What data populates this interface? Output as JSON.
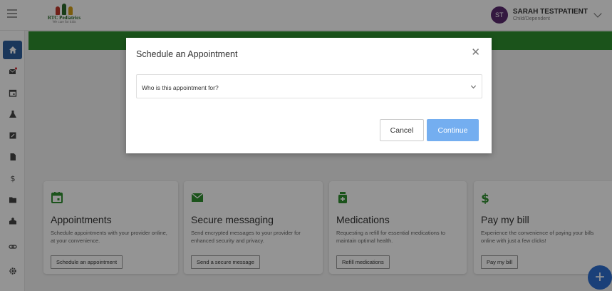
{
  "header": {
    "logo": {
      "name": "RTC Pediatrics",
      "tagline": "We care for kids"
    },
    "user": {
      "initials": "ST",
      "name": "SARAH TESTPATIENT",
      "role": "Child/Dependent"
    }
  },
  "sidebar": {
    "items": [
      {
        "icon": "home-icon",
        "active": true
      },
      {
        "icon": "mail-icon",
        "badge": true
      },
      {
        "icon": "calendar-icon"
      },
      {
        "icon": "flask-icon"
      },
      {
        "icon": "edit-icon"
      },
      {
        "icon": "document-icon"
      },
      {
        "icon": "dollar-icon"
      },
      {
        "icon": "folder-icon"
      },
      {
        "icon": "health-icon"
      },
      {
        "icon": "link-icon"
      },
      {
        "icon": "gear-icon"
      }
    ]
  },
  "cards": [
    {
      "icon": "calendar-icon",
      "title": "Appointments",
      "description": "Schedule appointments with your provider online, at your convenience.",
      "button": "Schedule an appointment"
    },
    {
      "icon": "mail-icon",
      "title": "Secure messaging",
      "description": "Send encrypted messages to your provider for enhanced security and privacy.",
      "button": "Send a secure message"
    },
    {
      "icon": "medication-icon",
      "title": "Medications",
      "description": "Requesting a refill for essential medications to maintain optimal health.",
      "button": "Refill medications"
    },
    {
      "icon": "dollar-icon",
      "title": "Pay my bill",
      "description": "Experience the convenience of paying your bills online with just a few clicks!",
      "button": "Pay my bill"
    }
  ],
  "fab": {
    "label": "+"
  },
  "modal": {
    "title": "Schedule an Appointment",
    "close": "✕",
    "select_label": "Who is this appointment for?",
    "cancel": "Cancel",
    "continue": "Continue"
  },
  "colors": {
    "brand_green": "#2f8f2f",
    "accent_blue": "#2d5f9e",
    "continue_button": "#74aef0",
    "avatar": "#5a2a6e"
  }
}
